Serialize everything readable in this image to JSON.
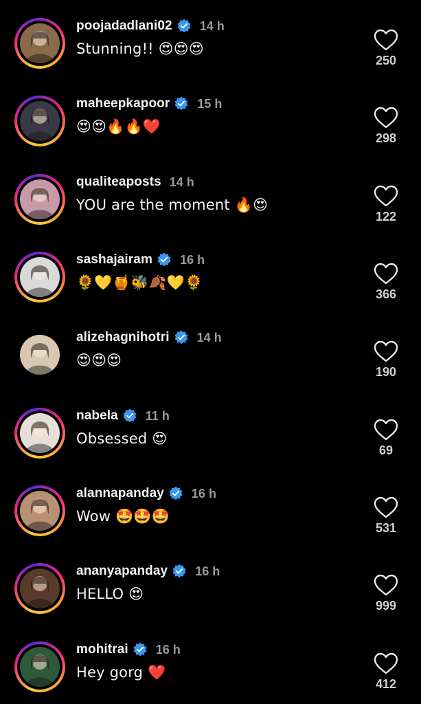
{
  "comments": [
    {
      "username": "poojadadlani02",
      "verified": true,
      "time": "14 h",
      "text": "Stunning!! 😍😍😍",
      "likes": "250",
      "avatar_color": "#8a6a4a",
      "ring": true
    },
    {
      "username": "maheepkapoor",
      "verified": true,
      "time": "15 h",
      "text": "😍😍🔥🔥❤️",
      "likes": "298",
      "avatar_color": "#3a3a46",
      "ring": true
    },
    {
      "username": "qualiteaposts",
      "verified": false,
      "time": "14 h",
      "text": "YOU are the moment 🔥😍",
      "likes": "122",
      "avatar_color": "#c89aa8",
      "ring": true
    },
    {
      "username": "sashajairam",
      "verified": true,
      "time": "16 h",
      "text": "🌻💛🍯🐝🍂💛🌻",
      "likes": "366",
      "avatar_color": "#d9d9d9",
      "ring": true
    },
    {
      "username": "alizehagnihotri",
      "verified": true,
      "time": "14 h",
      "text": "😍😍😍",
      "likes": "190",
      "avatar_color": "#d8c6b0",
      "ring": false
    },
    {
      "username": "nabela",
      "verified": true,
      "time": "11 h",
      "text": "Obsessed 😍",
      "likes": "69",
      "avatar_color": "#e8e0d8",
      "ring": true
    },
    {
      "username": "alannapanday",
      "verified": true,
      "time": "16 h",
      "text": "Wow 🤩🤩🤩",
      "likes": "531",
      "avatar_color": "#b89074",
      "ring": true
    },
    {
      "username": "ananyapanday",
      "verified": true,
      "time": "16 h",
      "text": "HELLO 😍",
      "likes": "999",
      "avatar_color": "#5a3a2a",
      "ring": true
    },
    {
      "username": "mohitrai",
      "verified": true,
      "time": "16 h",
      "text": "Hey gorg ❤️",
      "likes": "412",
      "avatar_color": "#2f5a3a",
      "ring": true
    }
  ],
  "colors": {
    "background": "#000000",
    "verified_badge": "#3897f0",
    "time_text": "#9a9a9a"
  },
  "icons": {
    "verified": "verified-badge-icon",
    "like": "heart-outline-icon"
  }
}
